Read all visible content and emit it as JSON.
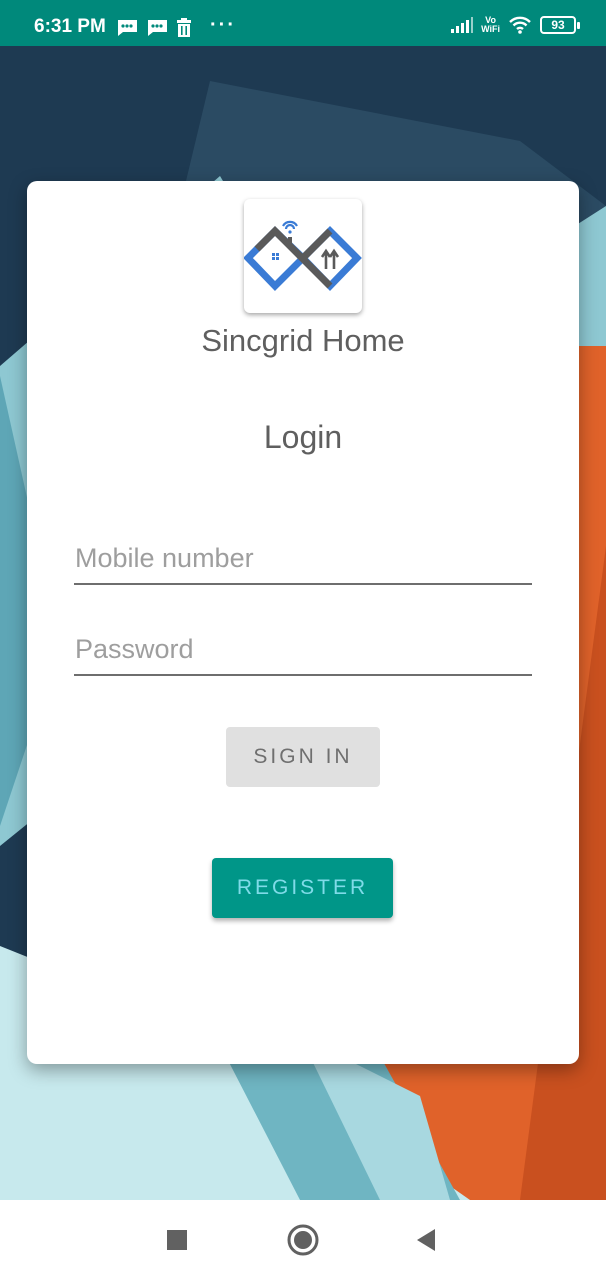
{
  "status_bar": {
    "time": "6:31 PM",
    "more": "···",
    "network_label_top": "Vo",
    "network_label_bottom": "WiFi",
    "battery": "93",
    "icons": [
      "message-icon",
      "message-icon",
      "trash-icon",
      "signal-icon",
      "wifi-icon",
      "battery-icon"
    ]
  },
  "login": {
    "app_name": "Sincgrid Home",
    "title": "Login",
    "mobile_placeholder": "Mobile number",
    "mobile_value": "",
    "password_placeholder": "Password",
    "password_value": "",
    "sign_in_label": "SIGN IN",
    "register_label": "REGISTER"
  },
  "nav_bar": {
    "icons": [
      "recents-square-icon",
      "home-circle-icon",
      "back-triangle-icon"
    ]
  },
  "colors": {
    "status_bar": "#00897b",
    "background_dark": "#1e3a52",
    "background_teal": "#6fb5c2",
    "background_orange": "#e0622a",
    "sign_in_bg": "#e0e0e0",
    "register_bg": "#009688",
    "register_text": "#7fdbe8"
  }
}
